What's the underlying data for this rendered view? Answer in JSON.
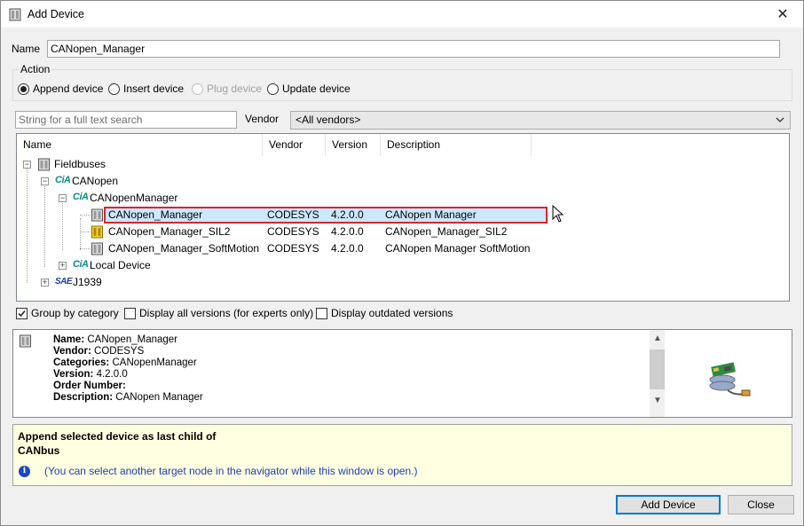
{
  "window": {
    "title": "Add Device",
    "close_glyph": "✕"
  },
  "name_field": {
    "label": "Name",
    "value": "CANopen_Manager"
  },
  "action": {
    "title": "Action",
    "options": [
      {
        "label": "Append device",
        "selected": true,
        "disabled": false
      },
      {
        "label": "Insert device",
        "selected": false,
        "disabled": false
      },
      {
        "label": "Plug device",
        "selected": false,
        "disabled": true
      },
      {
        "label": "Update device",
        "selected": false,
        "disabled": false
      }
    ]
  },
  "search": {
    "placeholder": "String for a full text search",
    "value": ""
  },
  "vendor": {
    "label": "Vendor",
    "selected": "<All vendors>"
  },
  "tree": {
    "columns": [
      "Name",
      "Vendor",
      "Version",
      "Description"
    ],
    "nodes": {
      "fieldbuses": "Fieldbuses",
      "canopen": "CANopen",
      "canopen_manager_cat": "CANopenManager",
      "local_device": "Local Device",
      "j1939": "J1939",
      "cia_logo": "CiA",
      "sae_logo": "SAE",
      "expand_plus": "+",
      "collapse_minus": "−"
    },
    "devices": [
      {
        "name": "CANopen_Manager",
        "vendor": "CODESYS",
        "version": "4.2.0.0",
        "description": "CANopen Manager",
        "selected": true,
        "icon": "device-module-icon"
      },
      {
        "name": "CANopen_Manager_SIL2",
        "vendor": "CODESYS",
        "version": "4.2.0.0",
        "description": "CANopen_Manager_SIL2",
        "selected": false,
        "icon": "device-module-sil2-icon"
      },
      {
        "name": "CANopen_Manager_SoftMotion",
        "vendor": "CODESYS",
        "version": "4.2.0.0",
        "description": "CANopen Manager SoftMotion",
        "selected": false,
        "icon": "device-module-icon"
      }
    ]
  },
  "options": {
    "group_by_category": {
      "label": "Group by category",
      "checked": true
    },
    "display_all_versions": {
      "label": "Display all versions (for experts only)",
      "checked": false
    },
    "display_outdated": {
      "label": "Display outdated versions",
      "checked": false
    }
  },
  "info": {
    "name_label": "Name:",
    "name_value": " CANopen_Manager",
    "vendor_label": "Vendor:",
    "vendor_value": " CODESYS",
    "categories_label": "Categories:",
    "categories_value": " CANopenManager",
    "version_label": "Version:",
    "version_value": " 4.2.0.0",
    "order_label": "Order Number:",
    "order_value": "",
    "description_label": "Description:",
    "description_value": " CANopen Manager",
    "scroll_up": "▲",
    "scroll_down": "▼"
  },
  "message": {
    "line1": "Append selected device as last child of",
    "line2": "CANbus",
    "note": "(You can select another target node in the navigator while this window is open.)",
    "info_glyph": "i"
  },
  "buttons": {
    "add_device": "Add Device",
    "close": "Close"
  },
  "colors": {
    "selection": "#cce8ff",
    "highlight_border": "#d9262c",
    "note_text": "#1e3fae",
    "message_bg": "#ffffe1",
    "default_button_border": "#0078d7"
  }
}
